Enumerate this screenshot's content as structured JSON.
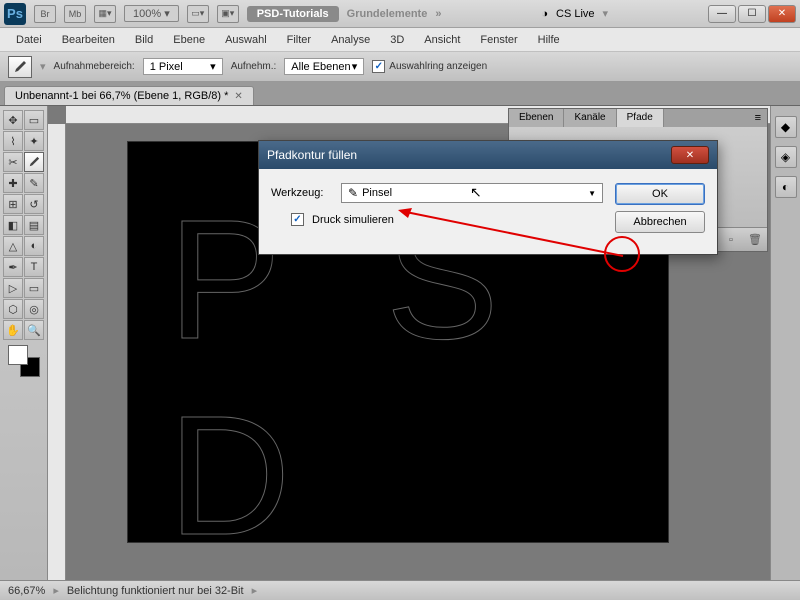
{
  "titlebar": {
    "zoom": "100%",
    "badge": "PSD-Tutorials",
    "sub": "Grundelemente",
    "cslive": "CS Live"
  },
  "menu": [
    "Datei",
    "Bearbeiten",
    "Bild",
    "Ebene",
    "Auswahl",
    "Filter",
    "Analyse",
    "3D",
    "Ansicht",
    "Fenster",
    "Hilfe"
  ],
  "options": {
    "sample_label": "Aufnahmebereich:",
    "sample_value": "1 Pixel",
    "sample2_label": "Aufnehm.:",
    "sample2_value": "Alle Ebenen",
    "ring_label": "Auswahlring anzeigen"
  },
  "doctab": "Unbenannt-1 bei 66,7% (Ebene 1, RGB/8) *",
  "canvas_text": "P S D",
  "panel": {
    "tabs": [
      "Ebenen",
      "Kanäle",
      "Pfade"
    ]
  },
  "dialog": {
    "title": "Pfadkontur füllen",
    "tool_label": "Werkzeug:",
    "tool_value": "Pinsel",
    "simulate_label": "Druck simulieren",
    "ok": "OK",
    "cancel": "Abbrechen"
  },
  "status": {
    "zoom": "66,67%",
    "msg": "Belichtung funktioniert nur bei 32-Bit"
  }
}
